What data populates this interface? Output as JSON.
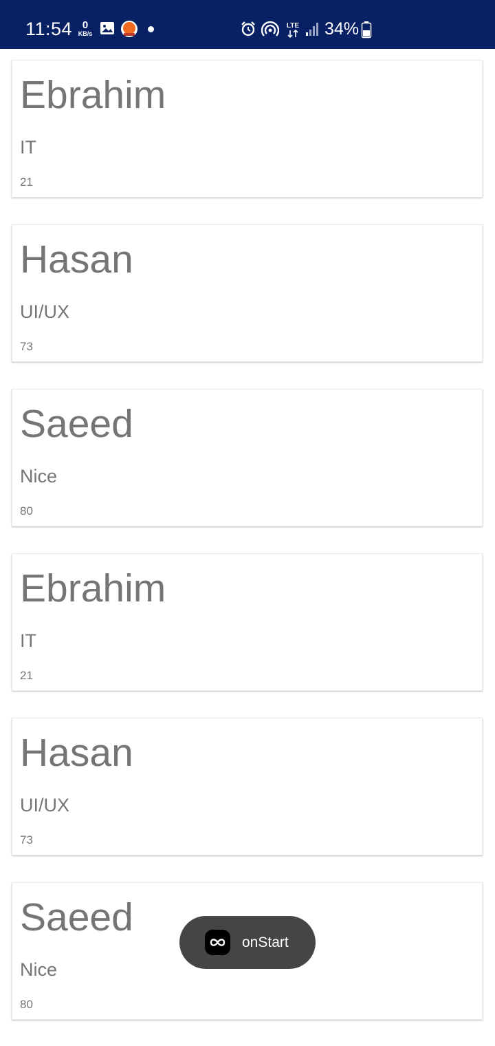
{
  "status_bar": {
    "time": "11:54",
    "net_speed_value": "0",
    "net_speed_unit": "KB/s",
    "network_type": "LTE",
    "battery_percent": "34%",
    "background_color": "#082164"
  },
  "list": {
    "items": [
      {
        "name": "Ebrahim",
        "department": "IT",
        "age": "21"
      },
      {
        "name": "Hasan",
        "department": "UI/UX",
        "age": "73"
      },
      {
        "name": "Saeed",
        "department": "Nice",
        "age": "80"
      },
      {
        "name": "Ebrahim",
        "department": "IT",
        "age": "21"
      },
      {
        "name": "Hasan",
        "department": "UI/UX",
        "age": "73"
      },
      {
        "name": "Saeed",
        "department": "Nice",
        "age": "80"
      }
    ]
  },
  "toast": {
    "text": "onStart",
    "icon": "infinity-icon"
  }
}
